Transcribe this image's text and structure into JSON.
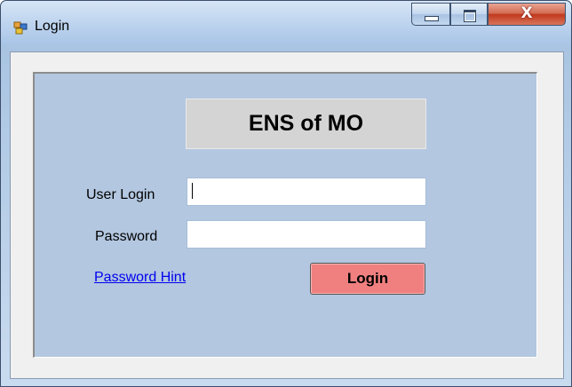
{
  "window": {
    "title": "Login",
    "icon": "application-window-icon",
    "controls": {
      "minimize_icon": "minimize-icon",
      "maximize_icon": "maximize-icon",
      "close_label": "X"
    }
  },
  "form": {
    "heading": "ENS of MO",
    "user_login_label": "User Login",
    "user_login_value": "",
    "password_label": "Password",
    "password_value": "",
    "password_hint_link": "Password Hint",
    "login_button": "Login"
  },
  "colors": {
    "panel_background": "#b3c7e0",
    "heading_box": "#d4d4d4",
    "login_button": "#f08080",
    "link": "#0000ee"
  }
}
